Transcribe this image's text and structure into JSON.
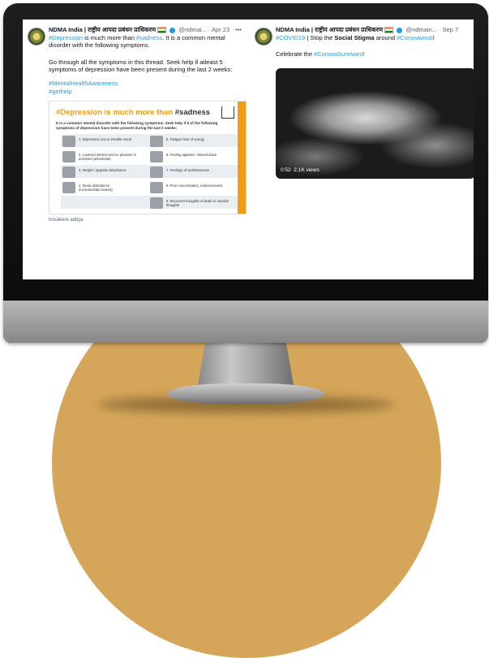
{
  "tweet1": {
    "name": "NDMA India | राष्ट्रीय आपदा प्रबंधन प्राधिकरण",
    "handle": "@ndmai...",
    "date": "· Apr 23",
    "more": "•••",
    "text_hashtag": "#Depression",
    "text_part1": " is much more than ",
    "text_hashtag2": "#sadness",
    "text_part2": ". It is a common mental disorder with the following symptoms.",
    "text_para2": "Go through all the symptoms in this thread. Seek help if  atleast 5 symptoms of depression have been present during the last 2 weeks:",
    "tag1": "#MentalHealthAwareness",
    "tag2": "#gethelp",
    "infographic": {
      "title_hashtag": "#Depression is much more than",
      "title_rest": " #sadness",
      "subtitle": "It is a common mental disorder with the following symptoms. Seek help if 5 of the following symptoms of depression have been present during the last 2 weeks:",
      "symptoms": [
        "1. Depressed, low or irritable mood",
        "5. Fatigue/ loss of energy",
        "2. Lowered interest and no pleasure in activities (anhedonia)",
        "6. Feeling agitated / slowed down",
        "3. Weight / appetite disturbance",
        "7. Feelings of worthlessness",
        "4. Sleep disturbance (increased/decreased)",
        "8. Poor concentration, indecisiveness",
        "9. Recurrent thoughts of death or suicidal thoughts"
      ]
    },
    "caption": "hosakere aditya"
  },
  "tweet2": {
    "name": "NDMA India | राष्ट्रीय आपदा प्रबंधन प्राधिकरण",
    "handle": "@ndmain...",
    "date": "· Sep 7",
    "tag_covid": "#COVID19",
    "text_part1": " | Stop the ",
    "bold": "Social Stigma",
    "text_part2": " around ",
    "tag_corona": "#Coronavirus",
    "text_part3": "!",
    "celebrate": "Celebrate the ",
    "tag_survivors": "#CoronaSurvivors",
    "excl": "!",
    "video_time": "0:52",
    "video_views": "2.1K views"
  },
  "colors": {
    "accent": "#1d9bf0",
    "circle": "#d5a65a",
    "infographic_orange": "#f39c12"
  }
}
